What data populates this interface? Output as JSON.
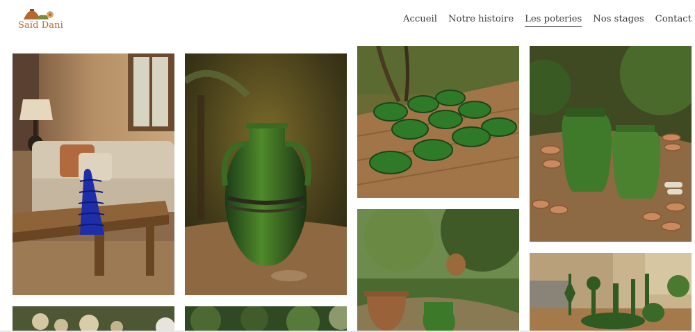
{
  "brand": {
    "name": "Saïd Dani",
    "logo_icon": "pottery-logo-icon",
    "accent": "#b5692e"
  },
  "nav": {
    "items": [
      {
        "label": "Accueil",
        "active": false
      },
      {
        "label": "Notre histoire",
        "active": false
      },
      {
        "label": "Les poteries",
        "active": true
      },
      {
        "label": "Nos stages",
        "active": false
      },
      {
        "label": "Contact",
        "active": false
      }
    ]
  },
  "gallery": {
    "images": [
      {
        "name": "blue-vase-living-room-photo"
      },
      {
        "name": "green-amphora-outdoor-photo"
      },
      {
        "name": "green-bowls-table-photo"
      },
      {
        "name": "green-jars-garden-photo"
      },
      {
        "name": "dried-flowers-photo"
      },
      {
        "name": "olive-trees-photo"
      },
      {
        "name": "garden-vase-photo"
      },
      {
        "name": "green-candlesticks-photo"
      }
    ]
  }
}
